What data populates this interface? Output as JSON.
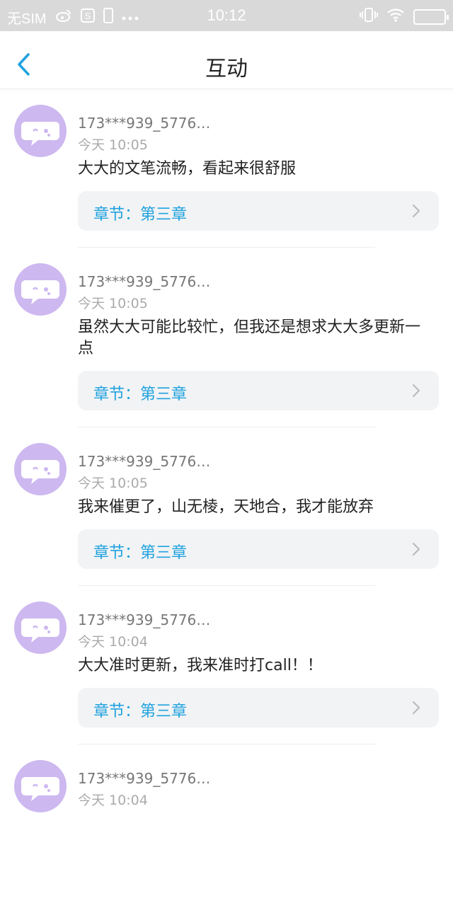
{
  "status_bar": {
    "carrier": "无SIM",
    "time": "10:12"
  },
  "header": {
    "title": "互动"
  },
  "comments": [
    {
      "username": "173***939_5776…",
      "time": "今天 10:05",
      "content": "大大的文笔流畅，看起来很舒服",
      "chapter": "章节：第三章"
    },
    {
      "username": "173***939_5776…",
      "time": "今天 10:05",
      "content": "虽然大大可能比较忙，但我还是想求大大多更新一点",
      "chapter": "章节：第三章"
    },
    {
      "username": "173***939_5776…",
      "time": "今天 10:05",
      "content": "我来催更了，山无棱，天地合，我才能放弃",
      "chapter": "章节：第三章"
    },
    {
      "username": "173***939_5776…",
      "time": "今天 10:04",
      "content": "大大准时更新，我来准时打call！！",
      "chapter": "章节：第三章"
    },
    {
      "username": "173***939_5776…",
      "time": "今天 10:04"
    }
  ],
  "colors": {
    "accent": "#1fa2df",
    "avatar_bg": "#cdb8f0",
    "status_bar_bg": "#d9d9d9"
  }
}
